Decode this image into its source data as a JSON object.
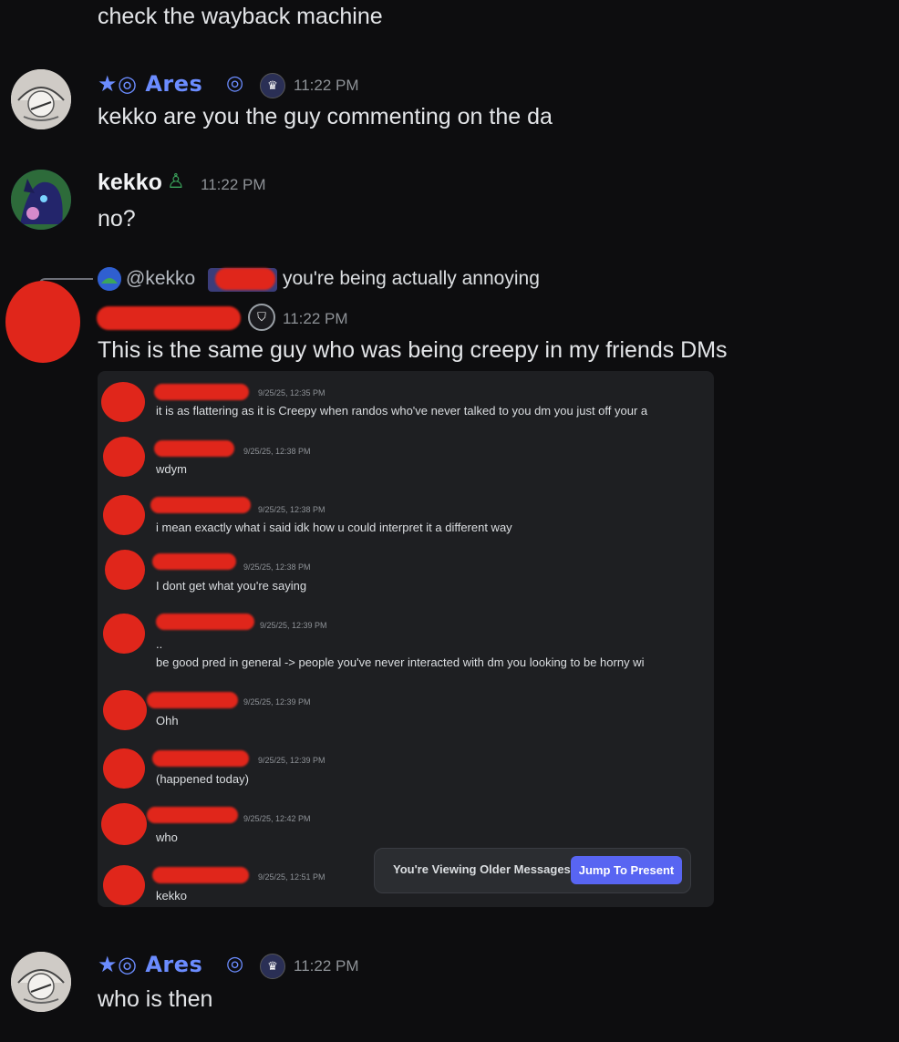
{
  "chat": {
    "top_line": "check the wayback machine",
    "msg1": {
      "author": "Ares",
      "author_prefix": "★◎",
      "time": "11:22 PM",
      "text": "kekko are you the guy commenting on the da"
    },
    "msg2": {
      "author": "kekko",
      "time": "11:22 PM",
      "text": "no?"
    },
    "reply": {
      "mention": "@kekko",
      "text": "you're being actually annoying"
    },
    "msg3": {
      "time": "11:22 PM",
      "text": "This is the same guy who was being creepy in my friends DMs"
    },
    "msg4": {
      "author": "Ares",
      "author_prefix": "★◎",
      "time": "11:22 PM",
      "text": "who is then"
    }
  },
  "embed": {
    "messages": [
      {
        "time": "9/25/25, 12:35 PM",
        "text": "it is as flattering as it is Creepy when randos who've never talked to you dm you just off your a"
      },
      {
        "time": "9/25/25, 12:38 PM",
        "text": "wdym"
      },
      {
        "time": "9/25/25, 12:38 PM",
        "text": "i mean exactly what i said idk how u could interpret it a different way"
      },
      {
        "time": "9/25/25, 12:38 PM",
        "text": "I dont get what you're saying"
      },
      {
        "time": "9/25/25, 12:39 PM",
        "text": "..",
        "text2": "be good pred in general -> people you've never interacted with dm you looking to be horny wi"
      },
      {
        "time": "9/25/25, 12:39 PM",
        "text": "Ohh"
      },
      {
        "time": "9/25/25, 12:39 PM",
        "text": "(happened today)"
      },
      {
        "time": "9/25/25, 12:42 PM",
        "text": "who"
      },
      {
        "time": "9/25/25, 12:51 PM",
        "text": "kekko"
      }
    ],
    "older_label": "You're Viewing Older Messages",
    "jump_label": "Jump To Present"
  },
  "colors": {
    "accent": "#5865f2",
    "ares_name": "#6b8cff",
    "redaction": "#e0261b",
    "online": "#3ba55c"
  }
}
